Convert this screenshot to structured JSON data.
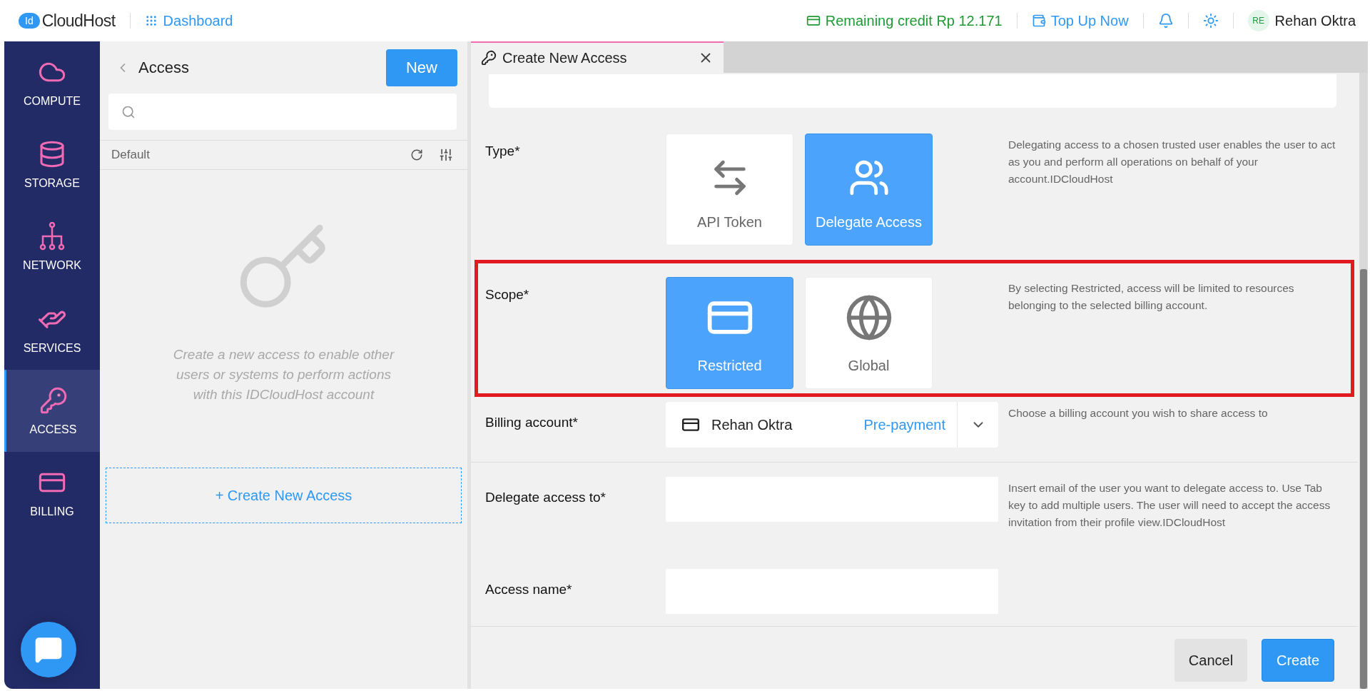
{
  "topbar": {
    "logo_badge": "Id",
    "logo_text": "CloudHost",
    "nav_link": "Dashboard",
    "credit": "Remaining credit Rp 12.171",
    "top_up": "Top Up Now",
    "user_initials": "RE",
    "user_name": "Rehan Oktra"
  },
  "sidebar": {
    "items": [
      {
        "label": "COMPUTE",
        "selected": false
      },
      {
        "label": "STORAGE",
        "selected": false
      },
      {
        "label": "NETWORK",
        "selected": false
      },
      {
        "label": "SERVICES",
        "selected": false
      },
      {
        "label": "ACCESS",
        "selected": true
      },
      {
        "label": "BILLING",
        "selected": false
      }
    ]
  },
  "access_panel": {
    "title": "Access",
    "new_button": "New",
    "group": "Default",
    "empty_text": "Create a new access to enable other users or systems to perform actions with this IDCloudHost account",
    "create_link": "+ Create New Access"
  },
  "tab": {
    "title": "Create New Access",
    "selected": true
  },
  "form": {
    "sections": [
      {
        "rows": [
          {
            "kind": "choice",
            "label": "Type*",
            "help": "Delegating access to a chosen trusted user enables the user to act as you and perform all operations on behalf of your account.IDCloudHost",
            "options": [
              {
                "label": "API Token",
                "selected": false
              },
              {
                "label": "Delegate Access",
                "selected": true
              }
            ]
          },
          {
            "kind": "choice",
            "label": "Scope*",
            "highlighted": true,
            "help": "By selecting Restricted, access will be limited to resources belonging to the selected billing account.",
            "options": [
              {
                "label": "Restricted",
                "selected": true
              },
              {
                "label": "Global",
                "selected": false
              }
            ]
          },
          {
            "kind": "select",
            "label": "Billing account*",
            "value": "Rehan Oktra",
            "tag": "Pre-payment",
            "help": "Choose a billing account you wish to share access to"
          }
        ]
      },
      {
        "rows": [
          {
            "kind": "input",
            "label": "Delegate access to*",
            "help": "Insert email of the user you want to delegate access to. Use Tab key to add multiple users. The user will need to accept the access invitation from their profile view.IDCloudHost"
          },
          {
            "kind": "input",
            "label": "Access name*"
          }
        ]
      }
    ],
    "buttons": [
      {
        "label": "Cancel",
        "kind": "secondary"
      },
      {
        "label": "Create",
        "kind": "primary"
      }
    ]
  }
}
